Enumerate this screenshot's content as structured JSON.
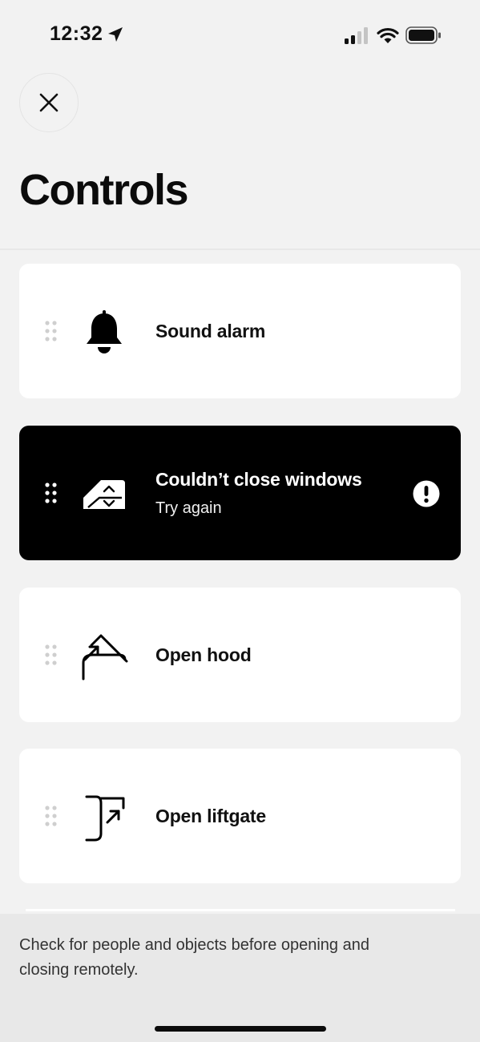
{
  "status_bar": {
    "time": "12:32",
    "icons": [
      "location-arrow-icon",
      "cellular-signal-icon",
      "wifi-icon",
      "battery-icon"
    ]
  },
  "header": {
    "close_icon": "close-icon",
    "title": "Controls"
  },
  "controls": [
    {
      "label": "Sound alarm",
      "icon": "bell-icon",
      "state": "normal"
    },
    {
      "label": "Couldn’t close windows",
      "sublabel": "Try again",
      "icon": "window-icon",
      "state": "error",
      "status_icon": "exclamation-icon"
    },
    {
      "label": "Open hood",
      "icon": "hood-icon",
      "state": "normal"
    },
    {
      "label": "Open liftgate",
      "icon": "liftgate-icon",
      "state": "normal"
    }
  ],
  "footer": {
    "note": "Check for people and objects before opening and closing remotely."
  },
  "colors": {
    "background": "#f2f2f2",
    "card": "#ffffff",
    "card_error": "#000000",
    "text": "#111111",
    "footer": "#e8e8e8"
  }
}
